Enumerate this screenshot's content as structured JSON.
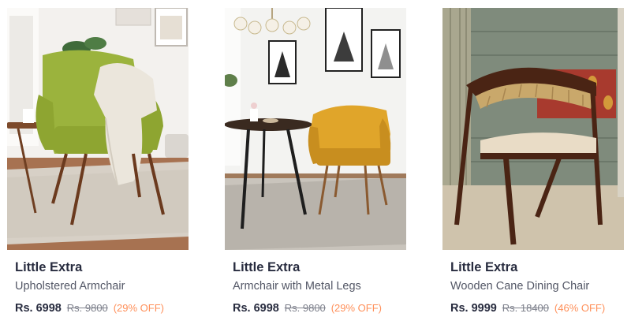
{
  "products": [
    {
      "brand": "Little Extra",
      "name": "Upholstered Armchair",
      "price": "Rs. 6998",
      "mrp": "Rs. 9800",
      "discount": "(29% OFF)"
    },
    {
      "brand": "Little Extra",
      "name": "Armchair with Metal Legs",
      "price": "Rs. 6998",
      "mrp": "Rs. 9800",
      "discount": "(29% OFF)"
    },
    {
      "brand": "Little Extra",
      "name": "Wooden Cane Dining Chair",
      "price": "Rs. 9999",
      "mrp": "Rs. 18400",
      "discount": "(46% OFF)"
    }
  ],
  "colors": {
    "brand_text": "#282c3f",
    "name_text": "#535766",
    "mrp_text": "#7e818c",
    "discount_text": "#ff905a"
  }
}
